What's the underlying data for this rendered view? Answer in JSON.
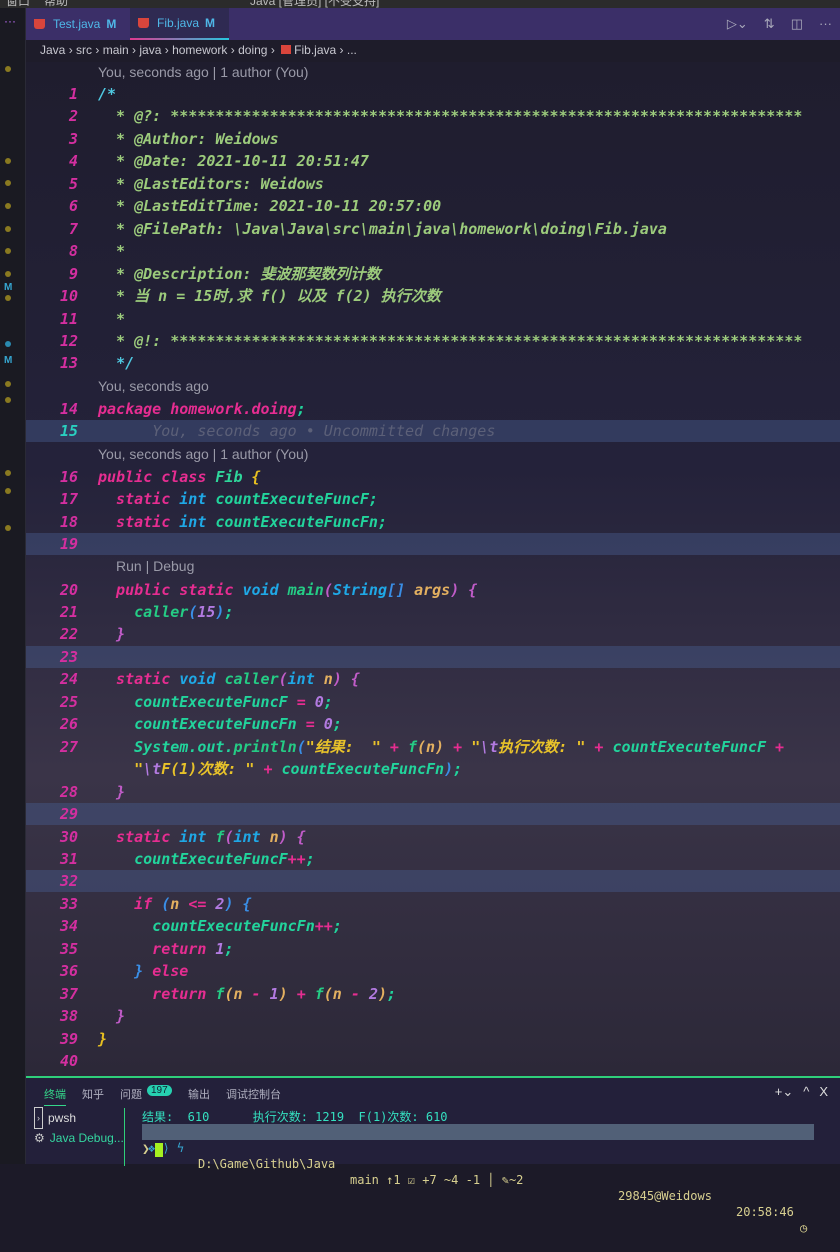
{
  "titlebar": {
    "menu": [
      "窗口",
      "帮助"
    ],
    "title": "Java [管理员] [不受支持]"
  },
  "activity_markers": [
    "M",
    "M"
  ],
  "tabs": [
    {
      "label": "Test.java",
      "status": "M",
      "active": false
    },
    {
      "label": "Fib.java",
      "status": "M",
      "active": true
    }
  ],
  "breadcrumb": [
    "Java",
    "src",
    "main",
    "java",
    "homework",
    "doing",
    "Fib.java",
    "..."
  ],
  "codelens": {
    "top": "You, seconds ago | 1 author (You)",
    "l14": "You, seconds ago",
    "l16": "You, seconds ago | 1 author (You)",
    "run_debug": "Run | Debug"
  },
  "blame_l15": "You, seconds ago • Uncommitted changes",
  "colors": {
    "accent": "#3b2f68",
    "line_number": "#d42fa0",
    "terminal_border": "#2fcf7a"
  },
  "code": [
    {
      "n": "1",
      "t": [
        [
          "/*",
          "cmc"
        ]
      ]
    },
    {
      "n": "2",
      "t": [
        [
          "  * @?: **********************************************************************",
          "cm"
        ]
      ]
    },
    {
      "n": "3",
      "t": [
        [
          "  * @Author: Weidows",
          "cm"
        ]
      ]
    },
    {
      "n": "4",
      "t": [
        [
          "  * @Date: 2021-10-11 20:51:47",
          "cm"
        ]
      ]
    },
    {
      "n": "5",
      "t": [
        [
          "  * @LastEditors: Weidows",
          "cm"
        ]
      ]
    },
    {
      "n": "6",
      "t": [
        [
          "  * @LastEditTime: 2021-10-11 20:57:00",
          "cm"
        ]
      ]
    },
    {
      "n": "7",
      "t": [
        [
          "  * @FilePath: \\Java\\Java\\src\\main\\java\\homework\\doing\\Fib.java",
          "cm"
        ]
      ]
    },
    {
      "n": "8",
      "t": [
        [
          "  *",
          "cm"
        ]
      ]
    },
    {
      "n": "9",
      "t": [
        [
          "  * @Description: 斐波那契数列计数",
          "cm"
        ]
      ]
    },
    {
      "n": "10",
      "t": [
        [
          "  * 当 n = 15时,求 f() 以及 f(2) 执行次数",
          "cm"
        ]
      ]
    },
    {
      "n": "11",
      "t": [
        [
          "  *",
          "cm"
        ]
      ]
    },
    {
      "n": "12",
      "t": [
        [
          "  * @!: **********************************************************************",
          "cm"
        ]
      ]
    },
    {
      "n": "13",
      "t": [
        [
          "  ",
          "cm"
        ],
        [
          "*/",
          "cmc"
        ]
      ]
    },
    {
      "n": "14",
      "t": [
        [
          "package homework.doing",
          "kw"
        ],
        [
          ";",
          "fd"
        ]
      ]
    },
    {
      "n": "15",
      "t": []
    },
    {
      "n": "16",
      "t": [
        [
          "public class ",
          "kw"
        ],
        [
          "Fib ",
          "cn"
        ],
        [
          "{",
          "br"
        ]
      ]
    },
    {
      "n": "17",
      "t": [
        [
          "  static ",
          "kw"
        ],
        [
          "int ",
          "ty"
        ],
        [
          "countExecuteFuncF;",
          "fd"
        ]
      ]
    },
    {
      "n": "18",
      "t": [
        [
          "  static ",
          "kw"
        ],
        [
          "int ",
          "ty"
        ],
        [
          "countExecuteFuncFn;",
          "fd"
        ]
      ]
    },
    {
      "n": "19",
      "t": []
    },
    {
      "n": "20",
      "t": [
        [
          "  public static ",
          "kw"
        ],
        [
          "void ",
          "ty"
        ],
        [
          "main",
          "fn"
        ],
        [
          "(",
          "bp"
        ],
        [
          "String",
          "ty"
        ],
        [
          "[] ",
          "bb"
        ],
        [
          "args",
          "pa"
        ],
        [
          ") {",
          "bp"
        ]
      ]
    },
    {
      "n": "21",
      "t": [
        [
          "    caller",
          "fn"
        ],
        [
          "(",
          "bb"
        ],
        [
          "15",
          "nu"
        ],
        [
          ")",
          "bb"
        ],
        [
          ";",
          "fd"
        ]
      ]
    },
    {
      "n": "22",
      "t": [
        [
          "  }",
          "bp"
        ]
      ]
    },
    {
      "n": "23",
      "t": []
    },
    {
      "n": "24",
      "t": [
        [
          "  static ",
          "kw"
        ],
        [
          "void ",
          "ty"
        ],
        [
          "caller",
          "fn"
        ],
        [
          "(",
          "bp"
        ],
        [
          "int ",
          "ty"
        ],
        [
          "n",
          "pa"
        ],
        [
          ") {",
          "bp"
        ]
      ]
    },
    {
      "n": "25",
      "t": [
        [
          "    countExecuteFuncF ",
          "fd"
        ],
        [
          "= ",
          "op"
        ],
        [
          "0",
          "nu"
        ],
        [
          ";",
          "fd"
        ]
      ]
    },
    {
      "n": "26",
      "t": [
        [
          "    countExecuteFuncFn ",
          "fd"
        ],
        [
          "= ",
          "op"
        ],
        [
          "0",
          "nu"
        ],
        [
          ";",
          "fd"
        ]
      ]
    },
    {
      "n": "27",
      "t": [
        [
          "    System.out.",
          "fd"
        ],
        [
          "println",
          "fn"
        ],
        [
          "(",
          "bb"
        ],
        [
          "\"结果:  \" ",
          "st"
        ],
        [
          "+ ",
          "op"
        ],
        [
          "f",
          "fn"
        ],
        [
          "(n) ",
          "pa"
        ],
        [
          "+ ",
          "op"
        ],
        [
          "\"",
          "st"
        ],
        [
          "\\t",
          "es"
        ],
        [
          "执行次数: \" ",
          "st"
        ],
        [
          "+ ",
          "op"
        ],
        [
          "countExecuteFuncF ",
          "fd"
        ],
        [
          "+",
          "op"
        ]
      ]
    },
    {
      "n": "",
      "t": [
        [
          "    \"",
          "st"
        ],
        [
          "\\t",
          "es"
        ],
        [
          "F(1)次数: \" ",
          "st"
        ],
        [
          "+ ",
          "op"
        ],
        [
          "countExecuteFuncFn",
          "fd"
        ],
        [
          ")",
          "bb"
        ],
        [
          ";",
          "fd"
        ]
      ]
    },
    {
      "n": "28",
      "t": [
        [
          "  }",
          "bp"
        ]
      ]
    },
    {
      "n": "29",
      "t": []
    },
    {
      "n": "30",
      "t": [
        [
          "  static ",
          "kw"
        ],
        [
          "int ",
          "ty"
        ],
        [
          "f",
          "fn"
        ],
        [
          "(",
          "bp"
        ],
        [
          "int ",
          "ty"
        ],
        [
          "n",
          "pa"
        ],
        [
          ") {",
          "bp"
        ]
      ]
    },
    {
      "n": "31",
      "t": [
        [
          "    countExecuteFuncF",
          "fd"
        ],
        [
          "++",
          "op"
        ],
        [
          ";",
          "fd"
        ]
      ]
    },
    {
      "n": "32",
      "t": []
    },
    {
      "n": "33",
      "t": [
        [
          "    if ",
          "kw"
        ],
        [
          "(",
          "bb"
        ],
        [
          "n ",
          "pa"
        ],
        [
          "<= ",
          "op"
        ],
        [
          "2",
          "nu"
        ],
        [
          ") {",
          "bb"
        ]
      ]
    },
    {
      "n": "34",
      "t": [
        [
          "      countExecuteFuncFn",
          "fd"
        ],
        [
          "++",
          "op"
        ],
        [
          ";",
          "fd"
        ]
      ]
    },
    {
      "n": "35",
      "t": [
        [
          "      return ",
          "kw"
        ],
        [
          "1",
          "nu"
        ],
        [
          ";",
          "fd"
        ]
      ]
    },
    {
      "n": "36",
      "t": [
        [
          "    } ",
          "bb"
        ],
        [
          "else",
          "kw"
        ]
      ]
    },
    {
      "n": "37",
      "t": [
        [
          "      return ",
          "kw"
        ],
        [
          "f",
          "fn"
        ],
        [
          "(n ",
          "pa"
        ],
        [
          "- ",
          "op"
        ],
        [
          "1",
          "nu"
        ],
        [
          ") ",
          "pa"
        ],
        [
          "+ ",
          "op"
        ],
        [
          "f",
          "fn"
        ],
        [
          "(n ",
          "pa"
        ],
        [
          "- ",
          "op"
        ],
        [
          "2",
          "nu"
        ],
        [
          ")",
          "pa"
        ],
        [
          ";",
          "fd"
        ]
      ]
    },
    {
      "n": "38",
      "t": [
        [
          "  }",
          "bp"
        ]
      ]
    },
    {
      "n": "39",
      "t": [
        [
          "}",
          "br"
        ]
      ]
    },
    {
      "n": "40",
      "t": []
    }
  ],
  "panel": {
    "tabs": [
      "终端",
      "知乎",
      "问题",
      "输出",
      "调试控制台"
    ],
    "problems_count": "197",
    "terminals": [
      "pwsh",
      "Java Debug..."
    ],
    "output": "结果:  610      执行次数: 1219  F(1)次数: 610",
    "prompt_path": "D:\\Game\\Github\\Java",
    "prompt_git": "main ↑1 ☑ +7 ~4 -1 │ ✎~2",
    "prompt_user": "29845@Weidows",
    "prompt_time": "20:58:46",
    "prompt_char": "❯"
  }
}
